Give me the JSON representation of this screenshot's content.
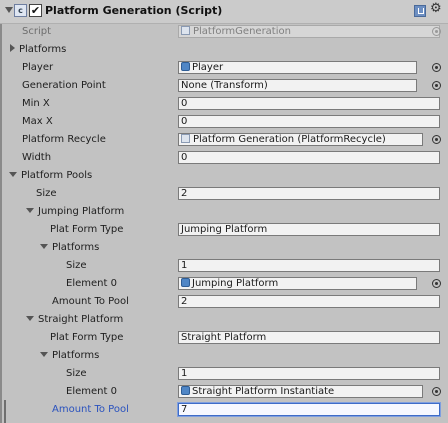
{
  "header": {
    "title": "Platform Generation (Script)",
    "icons": [
      "fold-arrow-icon",
      "script-file-icon",
      "enabled-checkbox",
      "help-book-icon",
      "gear-icon"
    ]
  },
  "rows": {
    "script": {
      "label": "Script",
      "value": "PlatformGeneration"
    },
    "platforms": {
      "label": "Platforms"
    },
    "player": {
      "label": "Player",
      "value": "Player"
    },
    "generation_point": {
      "label": "Generation Point",
      "value": "None (Transform)"
    },
    "min_x": {
      "label": "Min X",
      "value": "0"
    },
    "max_x": {
      "label": "Max X",
      "value": "0"
    },
    "platform_recycle": {
      "label": "Platform Recycle",
      "value": "Platform Generation (PlatformRecycle)"
    },
    "width": {
      "label": "Width",
      "value": "0"
    },
    "platform_pools": {
      "label": "Platform Pools"
    },
    "pools_size": {
      "label": "Size",
      "value": "2"
    },
    "jumping": {
      "label": "Jumping Platform",
      "type_label": "Plat Form Type",
      "type_value": "Jumping Platform",
      "platforms_label": "Platforms",
      "size_label": "Size",
      "size_value": "1",
      "element_label": "Element 0",
      "element_value": "Jumping Platform",
      "amount_label": "Amount To Pool",
      "amount_value": "2"
    },
    "straight": {
      "label": "Straight Platform",
      "type_label": "Plat Form Type",
      "type_value": "Straight Platform",
      "platforms_label": "Platforms",
      "size_label": "Size",
      "size_value": "1",
      "element_label": "Element 0",
      "element_value": "Straight Platform Instantiate",
      "amount_label": "Amount To Pool",
      "amount_value": "7"
    }
  }
}
